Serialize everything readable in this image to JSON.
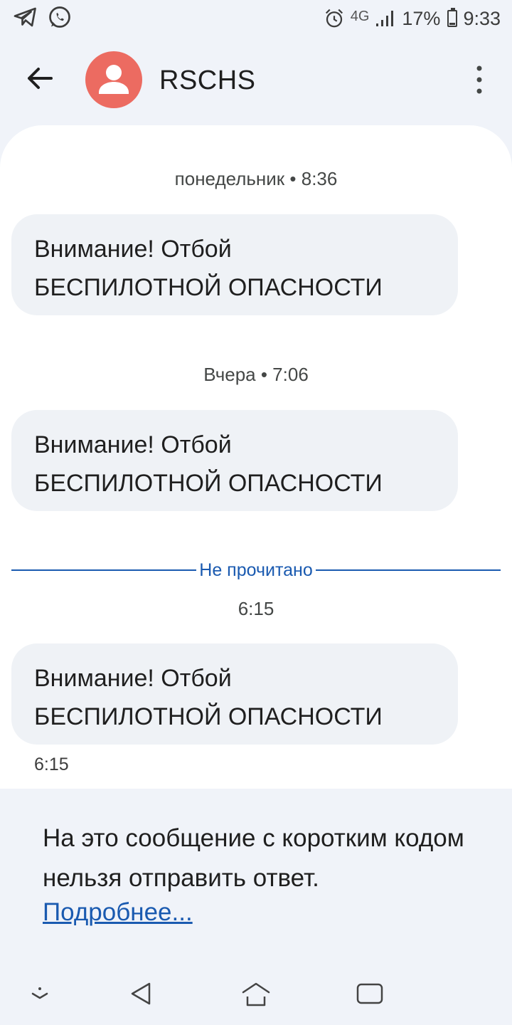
{
  "status_bar": {
    "left_icons": [
      "telegram-icon",
      "whatsapp-icon"
    ],
    "alarm_icon": "alarm-icon",
    "network": "4G",
    "battery": "17%",
    "time": "9:33"
  },
  "header": {
    "contact_name": "RSCHS",
    "avatar_color": "#ec6b61"
  },
  "messages": [
    {
      "timestamp": "понедельник • 8:36",
      "line1": "Внимание! Отбой",
      "line2": "БЕСПИЛОТНОЙ ОПАСНОСТИ"
    },
    {
      "timestamp": "Вчера • 7:06",
      "line1": "Внимание! Отбой",
      "line2": "БЕСПИЛОТНОЙ ОПАСНОСТИ"
    },
    {
      "timestamp": "6:15",
      "line1": "Внимание! Отбой",
      "line2": "БЕСПИЛОТНОЙ ОПАСНОСТИ",
      "time_below": "6:15"
    }
  ],
  "unread_label": "Не прочитано",
  "notice": {
    "text": "На это сообщение с коротким кодом нельзя отправить ответ.",
    "link": "Подробнее..."
  },
  "colors": {
    "accent": "#1a5ab0",
    "bubble": "#eff2f6",
    "background": "#f0f3f9"
  }
}
